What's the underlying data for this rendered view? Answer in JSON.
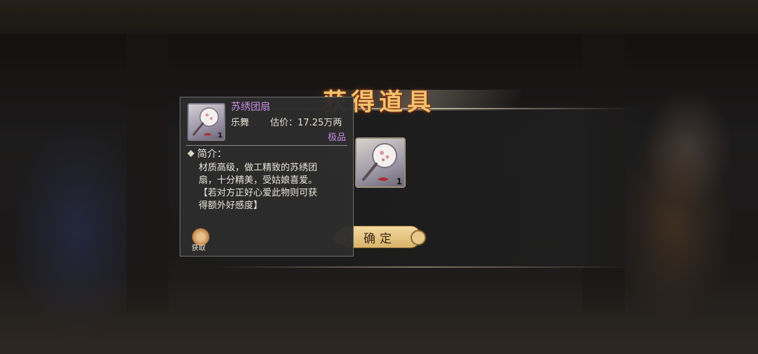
{
  "banner": {
    "title": "获得道具"
  },
  "reward": {
    "quantity": "1",
    "icon": "fan-icon"
  },
  "confirm": {
    "label": "确定"
  },
  "tooltip": {
    "item_name": "苏绣团扇",
    "item_type": "乐舞",
    "price": "估价：17.25万两",
    "quality": "极品",
    "quantity": "1",
    "desc_title": "简介：",
    "desc_lines": [
      "材质高级，做工精致的苏绣团",
      "扇，十分精美，受姑娘喜爱。",
      "【若对方正好心爱此物则可获",
      "得额外好感度】"
    ],
    "source_label": "获取"
  },
  "colors": {
    "title_gold": "#f1c46d",
    "quality_purple": "#c58ce0",
    "button_gold": "#d9b46a"
  }
}
